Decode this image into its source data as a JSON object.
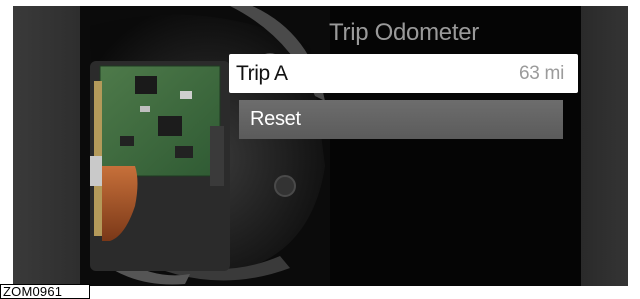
{
  "menu": {
    "title": "Trip Odometer",
    "items": [
      {
        "label": "Trip A",
        "value": "63 mi",
        "selected": true
      },
      {
        "label": "Reset"
      }
    ]
  },
  "figure_ref": "ZOM0961",
  "colors": {
    "screen_bg": "#050505",
    "title_text": "#9a9a9a",
    "selected_row_bg": "#ffffff",
    "item_row_bg": "#626262"
  }
}
